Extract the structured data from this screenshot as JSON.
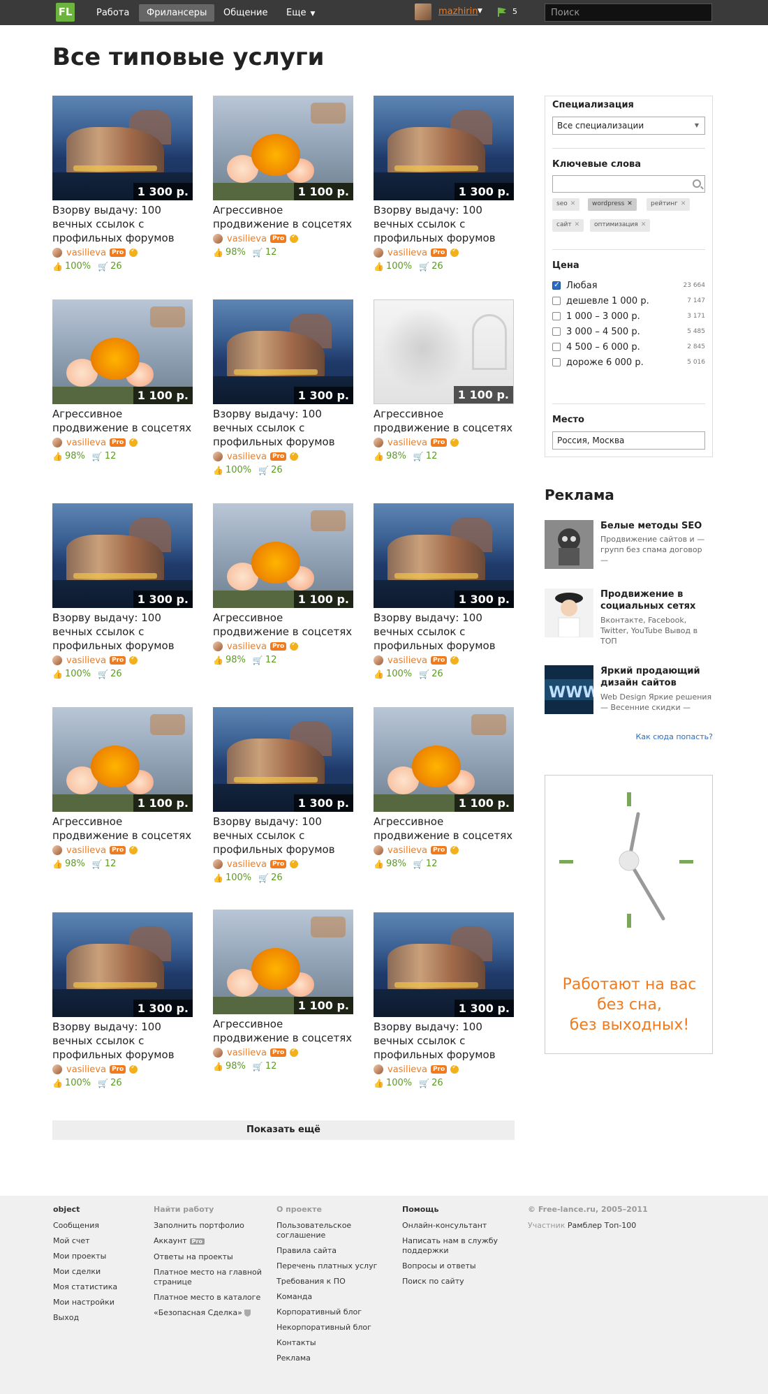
{
  "header": {
    "logo": "FL",
    "nav": [
      {
        "label": "Работа"
      },
      {
        "label": "Фрилансеры"
      },
      {
        "label": "Общение"
      },
      {
        "label": "Еще"
      }
    ],
    "user_name": "mazhirin",
    "flag_count": "5",
    "search_placeholder": "Поиск"
  },
  "page_title": "Все типовые услуги",
  "services": [
    {
      "title": "Взорву выдачу: 100 вечных ссылок с профильных форумов",
      "price": "1 300 р.",
      "author": "vasilieva",
      "pro": "Pro",
      "rating": "100%",
      "orders": "26",
      "image": "city"
    },
    {
      "title": "Агрессивное продвижение в соцсетях",
      "price": "1 100 р.",
      "author": "vasilieva",
      "pro": "Pro",
      "rating": "98%",
      "orders": "12",
      "image": "flower"
    },
    {
      "title": "Взорву выдачу: 100 вечных ссылок с профильных форумов",
      "price": "1 300 р.",
      "author": "vasilieva",
      "pro": "Pro",
      "rating": "100%",
      "orders": "26",
      "image": "city"
    },
    {
      "title": "Агрессивное продвижение в соцсетях",
      "price": "1 100 р.",
      "author": "vasilieva",
      "pro": "Pro",
      "rating": "98%",
      "orders": "12",
      "image": "flower"
    },
    {
      "title": "Взорву выдачу: 100 вечных ссылок с профильных форумов",
      "price": "1 300 р.",
      "author": "vasilieva",
      "pro": "Pro",
      "rating": "100%",
      "orders": "26",
      "image": "city"
    },
    {
      "title": "Агрессивное продвижение в соцсетях",
      "price": "1 100 р.",
      "author": "vasilieva",
      "pro": "Pro",
      "rating": "98%",
      "orders": "12",
      "image": "snow"
    },
    {
      "title": "Взорву выдачу: 100 вечных ссылок с профильных форумов",
      "price": "1 300 р.",
      "author": "vasilieva",
      "pro": "Pro",
      "rating": "100%",
      "orders": "26",
      "image": "city"
    },
    {
      "title": "Агрессивное продвижение в соцсетях",
      "price": "1 100 р.",
      "author": "vasilieva",
      "pro": "Pro",
      "rating": "98%",
      "orders": "12",
      "image": "flower"
    },
    {
      "title": "Взорву выдачу: 100 вечных ссылок с профильных форумов",
      "price": "1 300 р.",
      "author": "vasilieva",
      "pro": "Pro",
      "rating": "100%",
      "orders": "26",
      "image": "city"
    },
    {
      "title": "Агрессивное продвижение в соцсетях",
      "price": "1 100 р.",
      "author": "vasilieva",
      "pro": "Pro",
      "rating": "98%",
      "orders": "12",
      "image": "flower"
    },
    {
      "title": "Взорву выдачу: 100 вечных ссылок с профильных форумов",
      "price": "1 300 р.",
      "author": "vasilieva",
      "pro": "Pro",
      "rating": "100%",
      "orders": "26",
      "image": "city"
    },
    {
      "title": "Агрессивное продвижение в соцсетях",
      "price": "1 100 р.",
      "author": "vasilieva",
      "pro": "Pro",
      "rating": "98%",
      "orders": "12",
      "image": "flower"
    },
    {
      "title": "Взорву выдачу: 100 вечных ссылок с профильных форумов",
      "price": "1 300 р.",
      "author": "vasilieva",
      "pro": "Pro",
      "rating": "100%",
      "orders": "26",
      "image": "city"
    },
    {
      "title": "Агрессивное продвижение в соцсетях",
      "price": "1 100 р.",
      "author": "vasilieva",
      "pro": "Pro",
      "rating": "98%",
      "orders": "12",
      "image": "flower"
    },
    {
      "title": "Взорву выдачу: 100 вечных ссылок с профильных форумов",
      "price": "1 300 р.",
      "author": "vasilieva",
      "pro": "Pro",
      "rating": "100%",
      "orders": "26",
      "image": "city"
    }
  ],
  "show_more": "Показать ещё",
  "filter": {
    "spec_heading": "Специализация",
    "spec_value": "Все специализации",
    "keywords_heading": "Ключевые слова",
    "tags": [
      "seo",
      "wordpress",
      "рейтинг",
      "сайт",
      "оптимизация"
    ],
    "price_heading": "Цена",
    "price_options": [
      {
        "label": "Любая",
        "count": "23 664",
        "checked": true
      },
      {
        "label": "дешевле 1 000 р.",
        "count": "7 147",
        "checked": false
      },
      {
        "label": "1 000 – 3 000 р.",
        "count": "3 171",
        "checked": false
      },
      {
        "label": "3 000 – 4 500 р.",
        "count": "5 485",
        "checked": false
      },
      {
        "label": "4 500 – 6 000 р.",
        "count": "2 845",
        "checked": false
      },
      {
        "label": "дороже 6 000 р.",
        "count": "5 016",
        "checked": false
      }
    ],
    "place_heading": "Место",
    "place_value": "Россия, Москва"
  },
  "ads": {
    "title": "Реклама",
    "items": [
      {
        "title": "Белые методы SEO",
        "desc": "Продвижение сайтов и — групп без спама договор —"
      },
      {
        "title": "Продвижение в социальных сетях",
        "desc": "Вконтакте, Facebook, Twitter, YouTube Вывод в ТОП"
      },
      {
        "title": "Яркий продающий дизайн сайтов",
        "desc": "Web Design Яркие решения — Весенние скидки —"
      }
    ],
    "link": "Как сюда попасть?",
    "banner_line1": "Работают на вас",
    "banner_line2": "без сна,",
    "banner_line3": "без выходных!"
  },
  "footer": {
    "col1": {
      "heading": "object",
      "links": [
        "Сообщения",
        "Мой счет",
        "Мои проекты",
        "Мои сделки",
        "Моя статистика",
        "Мои настройки",
        "Выход"
      ]
    },
    "col2": {
      "heading": "Найти работу",
      "links": [
        "Заполнить портфолио",
        "Аккаунт",
        "Ответы на проекты",
        "Платное место на главной странице",
        "Платное место в каталоге",
        "«Безопасная Сделка»"
      ],
      "pro": "Pro"
    },
    "col3": {
      "heading": "О проекте",
      "links": [
        "Пользовательское соглашение",
        "Правила сайта",
        "Перечень платных услуг",
        "Требования к ПО",
        "Команда",
        "Корпоративный блог",
        "Некорпоративный блог",
        "Контакты",
        "Реклама"
      ]
    },
    "col4": {
      "heading": "Помощь",
      "links": [
        "Онлайн-консультант",
        "Написать нам в службу поддержки",
        "Вопросы и ответы",
        "Поиск по сайту"
      ]
    },
    "col5": {
      "heading": "© Free-lance.ru, 2005–2011",
      "participant": "Участник",
      "rambler": "Рамблер Топ-100"
    }
  },
  "colors": {
    "brand_green": "#6db33f",
    "accent_orange": "#f07b1e",
    "stats_green": "#5a9d1e",
    "link_blue": "#2a6cc4"
  }
}
